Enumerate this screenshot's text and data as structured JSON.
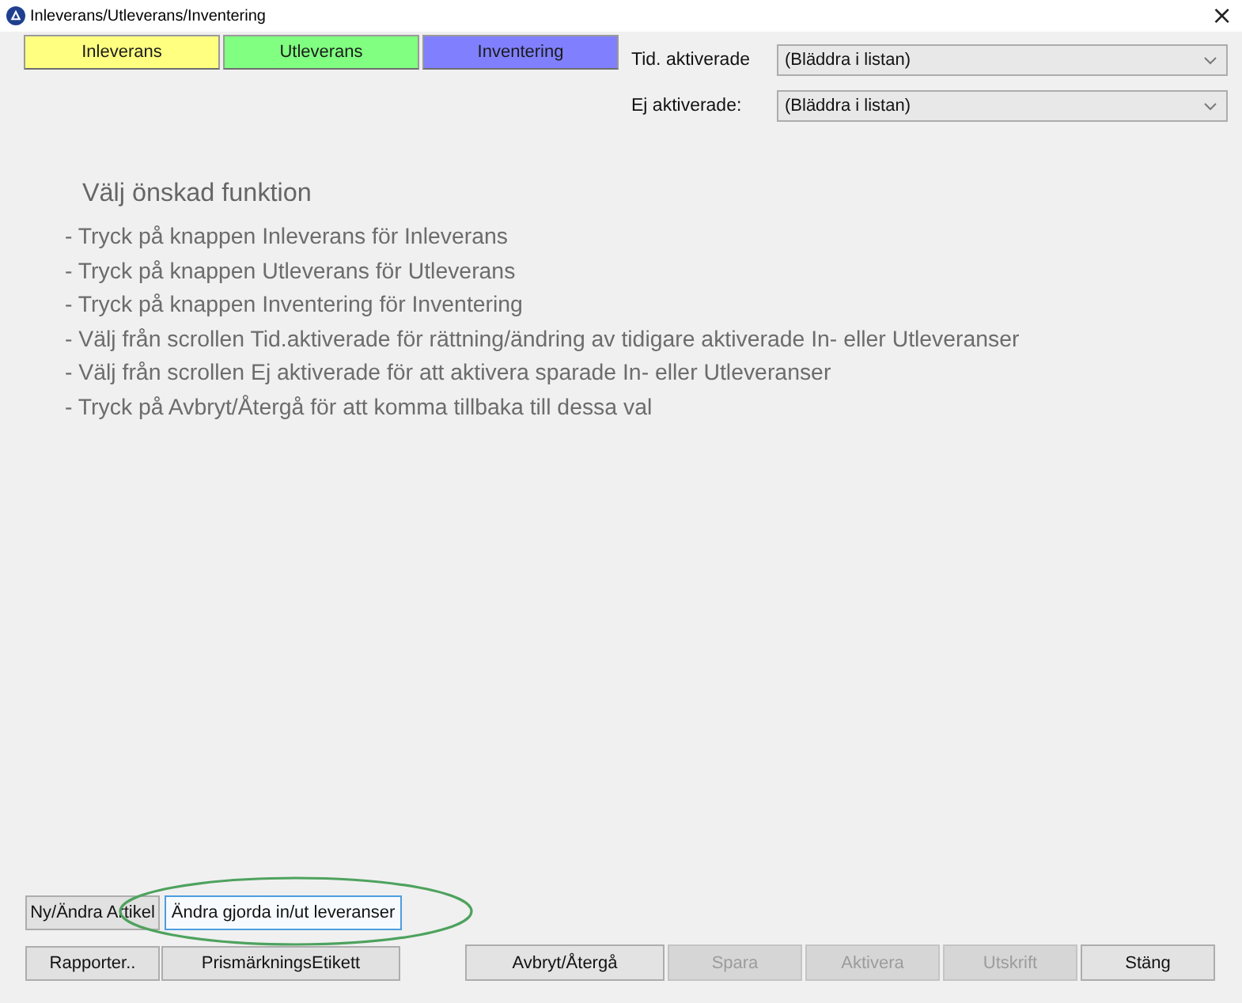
{
  "window": {
    "title": "Inleverans/Utleverans/Inventering",
    "close": "×"
  },
  "modes": [
    {
      "label": "Inleverans",
      "color": "#ffff80"
    },
    {
      "label": "Utleverans",
      "color": "#80ff80"
    },
    {
      "label": "Inventering",
      "color": "#8080ff"
    }
  ],
  "filters": [
    {
      "label": "Tid. aktiverade",
      "value": "(Bläddra i listan)"
    },
    {
      "label": "Ej aktiverade:",
      "value": "(Bläddra i listan)"
    }
  ],
  "instructions": {
    "heading": "Välj önskad funktion",
    "lines": [
      "- Tryck på knappen Inleverans för Inleverans",
      "- Tryck på knappen Utleverans för Utleverans",
      "- Tryck på knappen Inventering för Inventering",
      "- Välj från scrollen Tid.aktiverade för rättning/ändring av tidigare aktiverade In- eller Utleveranser",
      "- Välj från scrollen Ej aktiverade för att aktivera sparade In- eller Utleveranser",
      "- Tryck på Avbryt/Återgå för att komma tillbaka till dessa val"
    ]
  },
  "tools": [
    [
      {
        "label": "Ny/Ändra Artikel",
        "focused": false
      },
      {
        "label": "Ändra gjorda in/ut leveranser",
        "focused": true
      }
    ],
    [
      {
        "label": "Rapporter..",
        "focused": false
      },
      {
        "label": "PrismärkningsEtikett",
        "focused": false
      }
    ]
  ],
  "actions": [
    {
      "label": "Avbryt/Återgå",
      "disabled": false
    },
    {
      "label": "Spara",
      "disabled": true
    },
    {
      "label": "Aktivera",
      "disabled": true
    },
    {
      "label": "Utskrift",
      "disabled": true
    },
    {
      "label": "Stäng",
      "disabled": false
    }
  ],
  "annotation": {
    "kind": "ellipse"
  }
}
